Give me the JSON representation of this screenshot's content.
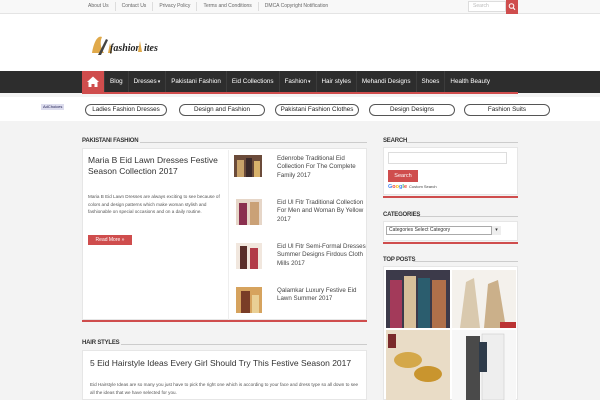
{
  "topbar": {
    "links": [
      "About Us",
      "Contact Us",
      "Privacy Policy",
      "Terms and Conditions",
      "DMCA Copyright Notification"
    ],
    "search_placeholder": "Search"
  },
  "nav": {
    "items": [
      {
        "label": "Blog",
        "dropdown": false
      },
      {
        "label": "Dresses",
        "dropdown": true
      },
      {
        "label": "Pakistani Fashion",
        "dropdown": false
      },
      {
        "label": "Eid Collections",
        "dropdown": false
      },
      {
        "label": "Fashion",
        "dropdown": true
      },
      {
        "label": "Hair styles",
        "dropdown": false
      },
      {
        "label": "Mehandi Designs",
        "dropdown": false
      },
      {
        "label": "Shoes",
        "dropdown": false
      },
      {
        "label": "Health Beauty",
        "dropdown": false
      }
    ]
  },
  "adchoices": "AdChoices",
  "pills": [
    "Ladies Fashion Dresses",
    "Design and Fashion",
    "Pakistani Fashion Clothes",
    "Design Designs",
    "Fashion Suits"
  ],
  "pakistani_fashion": {
    "heading": "PAKISTANI FASHION",
    "featured": {
      "title": "Maria B Eid Lawn Dresses Festive Season Collection 2017",
      "excerpt": "Maria B Eid Lawn Dresses are always exciting to see because of colors and design patterns which make woman stylish and fashionable on special occasions and on a daily routine.",
      "read_more": "Read More »"
    },
    "list": [
      "Edenrobe Traditional Eid Collection For The Complete Family 2017",
      "Eid Ul Fitr Traditional Collection For Men and Woman By Yellow 2017",
      "Eid Ul Fitr Semi-Formal Dresses Summer Designs Firdous Cloth Mills 2017",
      "Qalamkar Luxury Festive Eid Lawn Summer 2017"
    ]
  },
  "hair_styles": {
    "heading": "HAIR STYLES",
    "title": "5 Eid Hairstyle Ideas Every Girl Should Try This Festive Season 2017",
    "excerpt": "Eid Hairstyle Ideas are so many you just have to pick the right one which is according to your face and dress type so all down to see all the ideas that we have selected for you."
  },
  "sidebar": {
    "search_heading": "SEARCH",
    "search_button": "Search",
    "google_label": "Google",
    "custom_search": "Custom Search",
    "categories_heading": "CATEGORIES",
    "category_select": "Categories Select Category",
    "top_posts_heading": "TOP POSTS"
  },
  "colors": {
    "accent": "#cf4d4d",
    "nav_bg": "#2d2d2d"
  }
}
